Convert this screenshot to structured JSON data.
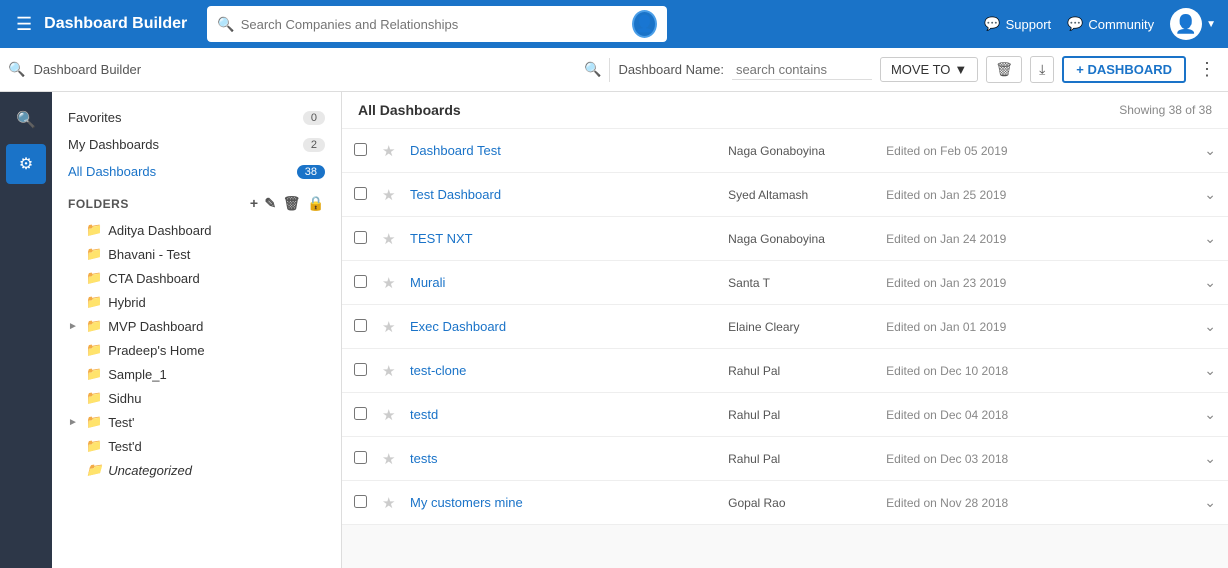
{
  "topNav": {
    "appTitle": "Dashboard Builder",
    "searchPlaceholder": "Search Companies and Relationships",
    "support": "Support",
    "community": "Community"
  },
  "secondBar": {
    "breadcrumb": "Dashboard Builder",
    "dbNameLabel": "Dashboard Name:",
    "dbNamePlaceholder": "search contains",
    "moveTo": "MOVE TO",
    "addDashboard": "+ DASHBOARD"
  },
  "filters": {
    "favorites": {
      "label": "Favorites",
      "count": "0"
    },
    "myDashboards": {
      "label": "My Dashboards",
      "count": "2"
    },
    "allDashboards": {
      "label": "All Dashboards",
      "count": "38"
    }
  },
  "folders": {
    "header": "FOLDERS",
    "items": [
      {
        "name": "Aditya Dashboard",
        "expanded": false,
        "hasArrow": false
      },
      {
        "name": "Bhavani - Test",
        "expanded": false,
        "hasArrow": false
      },
      {
        "name": "CTA Dashboard",
        "expanded": false,
        "hasArrow": false
      },
      {
        "name": "Hybrid",
        "expanded": false,
        "hasArrow": false
      },
      {
        "name": "MVP Dashboard",
        "expanded": true,
        "hasArrow": true
      },
      {
        "name": "Pradeep's Home",
        "expanded": false,
        "hasArrow": false
      },
      {
        "name": "Sample_1",
        "expanded": false,
        "hasArrow": false
      },
      {
        "name": "Sidhu",
        "expanded": false,
        "hasArrow": false
      },
      {
        "name": "Test'",
        "expanded": true,
        "hasArrow": true
      },
      {
        "name": "Test'd",
        "expanded": false,
        "hasArrow": false
      },
      {
        "name": "Uncategorized",
        "expanded": false,
        "hasArrow": false,
        "italic": true
      }
    ]
  },
  "allDashboards": {
    "title": "All Dashboards",
    "showing": "Showing 38 of 38",
    "rows": [
      {
        "name": "Dashboard Test",
        "owner": "Naga Gonaboyina",
        "edited": "Edited on Feb 05 2019"
      },
      {
        "name": "Test Dashboard",
        "owner": "Syed Altamash",
        "edited": "Edited on Jan 25 2019"
      },
      {
        "name": "TEST NXT",
        "owner": "Naga Gonaboyina",
        "edited": "Edited on Jan 24 2019"
      },
      {
        "name": "Murali",
        "owner": "Santa T",
        "edited": "Edited on Jan 23 2019"
      },
      {
        "name": "Exec Dashboard",
        "owner": "Elaine Cleary",
        "edited": "Edited on Jan 01 2019"
      },
      {
        "name": "test-clone",
        "owner": "Rahul Pal",
        "edited": "Edited on Dec 10 2018"
      },
      {
        "name": "testd",
        "owner": "Rahul Pal",
        "edited": "Edited on Dec 04 2018"
      },
      {
        "name": "tests",
        "owner": "Rahul Pal",
        "edited": "Edited on Dec 03 2018"
      },
      {
        "name": "My customers mine",
        "owner": "Gopal Rao",
        "edited": "Edited on Nov 28 2018"
      }
    ]
  }
}
